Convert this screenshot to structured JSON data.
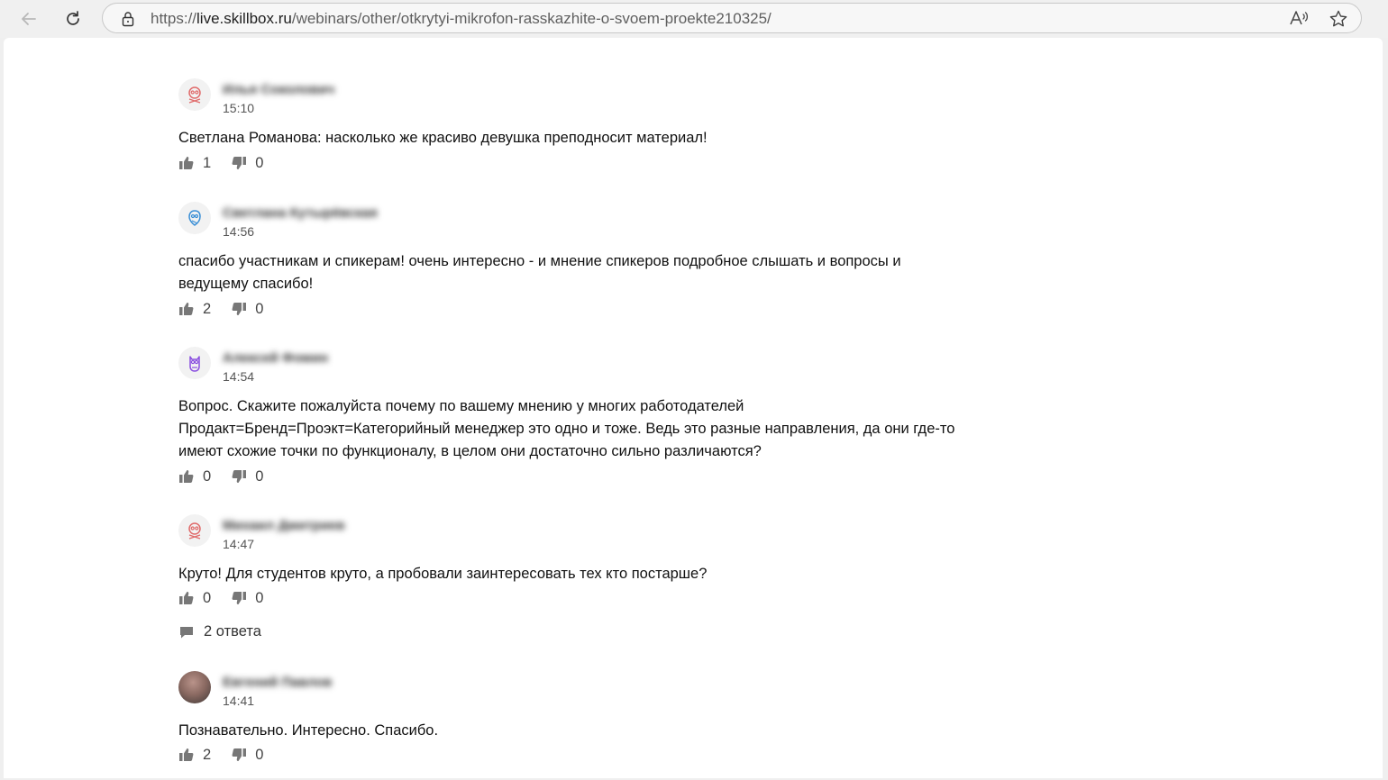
{
  "browser": {
    "url_scheme": "https://",
    "url_host": "live.skillbox.ru",
    "url_path": "/webinars/other/otkrytyi-mikrofon-rasskazhite-o-svoem-proekte210325/"
  },
  "comments": [
    {
      "author": "Илья Соколович",
      "time": "15:10",
      "avatar_icon": "owl-avatar-icon",
      "avatar_color": "#e06b6b",
      "text": "Светлана Романова: насколько же красиво девушка преподносит материал!",
      "likes": "1",
      "dislikes": "0"
    },
    {
      "author": "Светлана Кутырёвская",
      "time": "14:56",
      "avatar_icon": "owl-avatar-icon",
      "avatar_color": "#3b8fd6",
      "text": "спасибо участникам и спикерам! очень интересно - и мнение спикеров подробное слышать и вопросы и ведущему спасибо!",
      "likes": "2",
      "dislikes": "0"
    },
    {
      "author": "Алексей Фомин",
      "time": "14:54",
      "avatar_icon": "owl-avatar-icon",
      "avatar_color": "#8a4fe0",
      "text": "Вопрос. Скажите пожалуйста почему по вашему мнению у многих работодателей Продакт=Бренд=Проэкт=Категорийный менеджер это одно и тоже. Ведь это разные направления, да они где-то имеют схожие точки по функционалу, в целом они достаточно сильно различаются?",
      "likes": "0",
      "dislikes": "0"
    },
    {
      "author": "Михаил Дмитриев",
      "time": "14:47",
      "avatar_icon": "owl-avatar-icon",
      "avatar_color": "#e06b6b",
      "text": "Круто! Для студентов круто, а пробовали заинтересовать тех кто постарше?",
      "likes": "0",
      "dislikes": "0",
      "replies_label": "2 ответа"
    },
    {
      "author": "Евгений Павлов",
      "time": "14:41",
      "avatar_icon": "user-photo-avatar",
      "text": "Познавательно. Интересно. Спасибо.",
      "likes": "2",
      "dislikes": "0"
    }
  ]
}
